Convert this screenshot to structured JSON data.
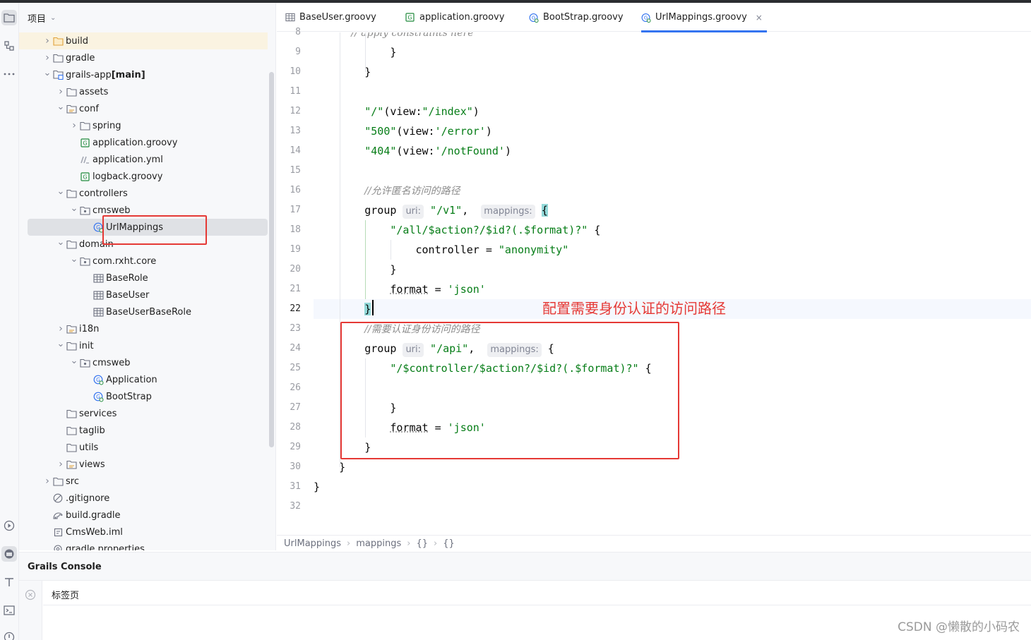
{
  "project_panel": {
    "title": "项目",
    "tree": [
      {
        "label": "build",
        "bold": "",
        "indent": 0,
        "arrow": "right",
        "icon": "folder-orange"
      },
      {
        "label": "gradle",
        "bold": "",
        "indent": 0,
        "arrow": "right",
        "icon": "folder"
      },
      {
        "label": "grails-app ",
        "bold": "[main]",
        "indent": 0,
        "arrow": "down",
        "icon": "module-folder"
      },
      {
        "label": "assets",
        "bold": "",
        "indent": 1,
        "arrow": "right",
        "icon": "folder"
      },
      {
        "label": "conf",
        "bold": "",
        "indent": 1,
        "arrow": "down",
        "icon": "resource-folder"
      },
      {
        "label": "spring",
        "bold": "",
        "indent": 2,
        "arrow": "right",
        "icon": "folder"
      },
      {
        "label": "application.groovy",
        "bold": "",
        "indent": 2,
        "arrow": "",
        "icon": "groovy-file"
      },
      {
        "label": "application.yml",
        "bold": "",
        "indent": 2,
        "arrow": "",
        "icon": "yaml-file"
      },
      {
        "label": "logback.groovy",
        "bold": "",
        "indent": 2,
        "arrow": "",
        "icon": "groovy-file"
      },
      {
        "label": "controllers",
        "bold": "",
        "indent": 1,
        "arrow": "down",
        "icon": "folder"
      },
      {
        "label": "cmsweb",
        "bold": "",
        "indent": 2,
        "arrow": "down",
        "icon": "package"
      },
      {
        "label": "UrlMappings",
        "bold": "",
        "indent": 3,
        "arrow": "",
        "icon": "groovy-class"
      },
      {
        "label": "domain",
        "bold": "",
        "indent": 1,
        "arrow": "down",
        "icon": "folder"
      },
      {
        "label": "com.rxht.core",
        "bold": "",
        "indent": 2,
        "arrow": "down",
        "icon": "package"
      },
      {
        "label": "BaseRole",
        "bold": "",
        "indent": 3,
        "arrow": "",
        "icon": "table"
      },
      {
        "label": "BaseUser",
        "bold": "",
        "indent": 3,
        "arrow": "",
        "icon": "table"
      },
      {
        "label": "BaseUserBaseRole",
        "bold": "",
        "indent": 3,
        "arrow": "",
        "icon": "table"
      },
      {
        "label": "i18n",
        "bold": "",
        "indent": 1,
        "arrow": "right",
        "icon": "resource-folder"
      },
      {
        "label": "init",
        "bold": "",
        "indent": 1,
        "arrow": "down",
        "icon": "folder"
      },
      {
        "label": "cmsweb",
        "bold": "",
        "indent": 2,
        "arrow": "down",
        "icon": "package"
      },
      {
        "label": "Application",
        "bold": "",
        "indent": 3,
        "arrow": "",
        "icon": "groovy-class"
      },
      {
        "label": "BootStrap",
        "bold": "",
        "indent": 3,
        "arrow": "",
        "icon": "groovy-class"
      },
      {
        "label": "services",
        "bold": "",
        "indent": 1,
        "arrow": "",
        "icon": "folder"
      },
      {
        "label": "taglib",
        "bold": "",
        "indent": 1,
        "arrow": "",
        "icon": "folder"
      },
      {
        "label": "utils",
        "bold": "",
        "indent": 1,
        "arrow": "",
        "icon": "folder"
      },
      {
        "label": "views",
        "bold": "",
        "indent": 1,
        "arrow": "right",
        "icon": "resource-folder"
      },
      {
        "label": "src",
        "bold": "",
        "indent": 0,
        "arrow": "right",
        "icon": "folder"
      },
      {
        "label": ".gitignore",
        "bold": "",
        "indent": 0,
        "arrow": "",
        "icon": "ignore-file"
      },
      {
        "label": "build.gradle",
        "bold": "",
        "indent": 0,
        "arrow": "",
        "icon": "gradle-file"
      },
      {
        "label": "CmsWeb.iml",
        "bold": "",
        "indent": 0,
        "arrow": "",
        "icon": "iml-file"
      },
      {
        "label": "gradle.properties",
        "bold": "",
        "indent": 0,
        "arrow": "",
        "icon": "properties-file"
      }
    ],
    "highlighted_index": 0,
    "selected_index": 11
  },
  "tabs": [
    {
      "label": "BaseUser.groovy",
      "icon": "table",
      "active": false
    },
    {
      "label": "application.groovy",
      "icon": "groovy-file",
      "active": false
    },
    {
      "label": "BootStrap.groovy",
      "icon": "groovy-class",
      "active": false
    },
    {
      "label": "UrlMappings.groovy",
      "icon": "groovy-class",
      "active": true,
      "close": "×"
    }
  ],
  "editor": {
    "current_line": "22",
    "lines": [
      {
        "n": "8",
        "tokens": [
          {
            "t": "            // apply constraints here",
            "k": "c"
          }
        ]
      },
      {
        "n": "9",
        "tokens": [
          {
            "t": "            }",
            "k": "k"
          }
        ]
      },
      {
        "n": "10",
        "tokens": [
          {
            "t": "        }",
            "k": "k"
          }
        ]
      },
      {
        "n": "11",
        "tokens": []
      },
      {
        "n": "12",
        "tokens": [
          {
            "t": "        ",
            "k": "k"
          },
          {
            "t": "\"/\"",
            "k": "s"
          },
          {
            "t": "(view:",
            "k": "k"
          },
          {
            "t": "\"/index\"",
            "k": "s"
          },
          {
            "t": ")",
            "k": "k"
          }
        ]
      },
      {
        "n": "13",
        "tokens": [
          {
            "t": "        ",
            "k": "k"
          },
          {
            "t": "\"500\"",
            "k": "s"
          },
          {
            "t": "(view:",
            "k": "k"
          },
          {
            "t": "'/error'",
            "k": "s"
          },
          {
            "t": ")",
            "k": "k"
          }
        ]
      },
      {
        "n": "14",
        "tokens": [
          {
            "t": "        ",
            "k": "k"
          },
          {
            "t": "\"404\"",
            "k": "s"
          },
          {
            "t": "(view:",
            "k": "k"
          },
          {
            "t": "'/notFound'",
            "k": "s"
          },
          {
            "t": ")",
            "k": "k"
          }
        ]
      },
      {
        "n": "15",
        "tokens": []
      },
      {
        "n": "16",
        "tokens": [
          {
            "t": "        ",
            "k": "k"
          },
          {
            "t": "//允许匿名访问的路径",
            "k": "c"
          }
        ]
      },
      {
        "n": "17",
        "tokens": [
          {
            "t": "        group ",
            "k": "k"
          },
          {
            "t": "uri:",
            "k": "hint"
          },
          {
            "t": " ",
            "k": "k"
          },
          {
            "t": "\"/v1\"",
            "k": "s"
          },
          {
            "t": ",  ",
            "k": "k"
          },
          {
            "t": "mappings:",
            "k": "hint"
          },
          {
            "t": " ",
            "k": "k"
          },
          {
            "t": "{",
            "k": "brace"
          }
        ]
      },
      {
        "n": "18",
        "tokens": [
          {
            "t": "            ",
            "k": "k"
          },
          {
            "t": "\"/all/$action?/$id?(.$format)?\"",
            "k": "s"
          },
          {
            "t": " {",
            "k": "k"
          }
        ]
      },
      {
        "n": "19",
        "tokens": [
          {
            "t": "                controller = ",
            "k": "k"
          },
          {
            "t": "\"anonymity\"",
            "k": "s"
          }
        ]
      },
      {
        "n": "20",
        "tokens": [
          {
            "t": "            }",
            "k": "k"
          }
        ]
      },
      {
        "n": "21",
        "tokens": [
          {
            "t": "            ",
            "k": "k"
          },
          {
            "t": "format",
            "k": "prop"
          },
          {
            "t": " = ",
            "k": "k"
          },
          {
            "t": "'json'",
            "k": "s"
          }
        ]
      },
      {
        "n": "22",
        "tokens": [
          {
            "t": "        ",
            "k": "k"
          },
          {
            "t": "}",
            "k": "brace"
          }
        ]
      },
      {
        "n": "23",
        "tokens": [
          {
            "t": "        ",
            "k": "k"
          },
          {
            "t": "//需要认证身份访问的路径",
            "k": "c"
          }
        ]
      },
      {
        "n": "24",
        "tokens": [
          {
            "t": "        group ",
            "k": "k"
          },
          {
            "t": "uri:",
            "k": "hint"
          },
          {
            "t": " ",
            "k": "k"
          },
          {
            "t": "\"/api\"",
            "k": "s"
          },
          {
            "t": ",  ",
            "k": "k"
          },
          {
            "t": "mappings:",
            "k": "hint"
          },
          {
            "t": " {",
            "k": "k"
          }
        ]
      },
      {
        "n": "25",
        "tokens": [
          {
            "t": "            ",
            "k": "k"
          },
          {
            "t": "\"/$controller/$action?/$id?(.$format)?\"",
            "k": "s"
          },
          {
            "t": " {",
            "k": "k"
          }
        ]
      },
      {
        "n": "26",
        "tokens": []
      },
      {
        "n": "27",
        "tokens": [
          {
            "t": "            }",
            "k": "k"
          }
        ]
      },
      {
        "n": "28",
        "tokens": [
          {
            "t": "            ",
            "k": "k"
          },
          {
            "t": "format",
            "k": "prop"
          },
          {
            "t": " = ",
            "k": "k"
          },
          {
            "t": "'json'",
            "k": "s"
          }
        ]
      },
      {
        "n": "29",
        "tokens": [
          {
            "t": "        }",
            "k": "k"
          }
        ]
      },
      {
        "n": "30",
        "tokens": [
          {
            "t": "    }",
            "k": "k"
          }
        ]
      },
      {
        "n": "31",
        "tokens": [
          {
            "t": "}",
            "k": "k"
          }
        ]
      },
      {
        "n": "32",
        "tokens": []
      }
    ],
    "annotation": "配置需要身份认证的访问路径"
  },
  "breadcrumb": [
    "UrlMappings",
    "mappings",
    "{}",
    "{}"
  ],
  "console": {
    "title": "Grails Console",
    "tab": "标签页"
  },
  "watermark": "CSDN @懒散的小码农",
  "colors": {
    "accent": "#3574f0",
    "string": "#067d17",
    "comment": "#8c8c8c",
    "annotation_red": "#e53935"
  }
}
